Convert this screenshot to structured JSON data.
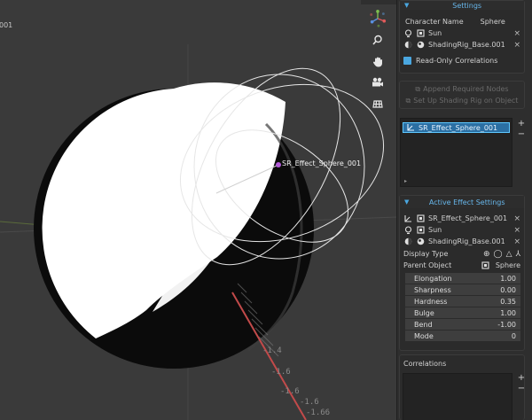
{
  "viewport": {
    "corner_label": "001",
    "object_label": "SR_Effect_Sphere_001",
    "axis_ticks": [
      "-1.4",
      "-1.6",
      "-1.6",
      "-1.6",
      "-1.66"
    ],
    "tools": [
      "navigation-gizmo",
      "zoom-icon",
      "hand-pan-icon",
      "camera-icon",
      "grid-icon"
    ]
  },
  "settings": {
    "title": "Settings",
    "character_name_label": "Character Name",
    "character_name_value": "Sphere",
    "sun_label": "Sun",
    "rig_label": "ShadingRig_Base.001",
    "read_only_label": "Read-Only Correlations",
    "append_button": "Append Required Nodes",
    "setup_button": "Set Up Shading Rig on Object"
  },
  "effects_list": {
    "items": [
      "SR_Effect_Sphere_001"
    ]
  },
  "active_effect": {
    "title": "Active Effect Settings",
    "effect_name": "SR_Effect_Sphere_001",
    "sun_label": "Sun",
    "rig_label": "ShadingRig_Base.001",
    "display_type_label": "Display Type",
    "parent_object_label": "Parent Object",
    "parent_object_value": "Sphere",
    "fields": [
      {
        "label": "Elongation",
        "value": "1.00"
      },
      {
        "label": "Sharpness",
        "value": "0.00"
      },
      {
        "label": "Hardness",
        "value": "0.35"
      },
      {
        "label": "Bulge",
        "value": "1.00"
      },
      {
        "label": "Bend",
        "value": "-1.00"
      },
      {
        "label": "Mode",
        "value": "0"
      }
    ]
  },
  "correlations": {
    "title": "Correlations"
  },
  "colors": {
    "accent": "#4aa7e0",
    "selection": "#2b6fa3",
    "viewport_bg": "#3a3a3a",
    "sphere_light": "#ffffff",
    "sphere_shadow": "#0a0a0a"
  }
}
